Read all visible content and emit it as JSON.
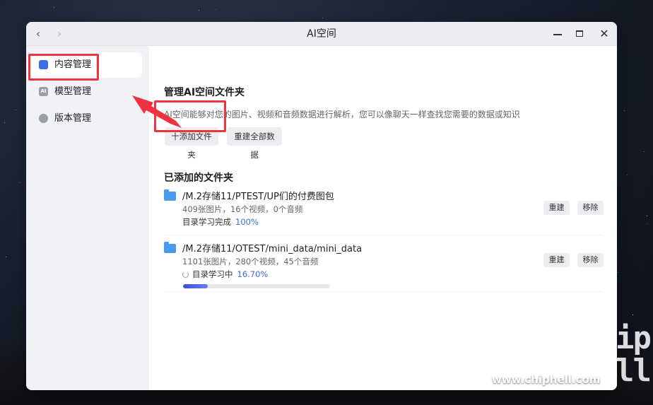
{
  "window": {
    "title": "AI空间",
    "nav_back": "‹",
    "nav_forward": "›",
    "minimize": "—",
    "maximize": "□",
    "close": "✕"
  },
  "sidebar": {
    "items": [
      {
        "label": "内容管理",
        "icon": "document-icon",
        "active": true
      },
      {
        "label": "模型管理",
        "icon": "ai-icon",
        "icon_text": "AI",
        "active": false
      },
      {
        "label": "版本管理",
        "icon": "version-icon",
        "active": false
      }
    ]
  },
  "main": {
    "manage_title": "管理AI空间文件夹",
    "manage_desc": "AI空间能够对您的图片、视频和音频数据进行解析，您可以像聊天一样查找您需要的数据或知识",
    "add_folder_label": "十添加文件夹",
    "rebuild_all_label": "重建全部数据",
    "added_title": "已添加的文件夹",
    "folders": [
      {
        "path": "/M.2存储11/PTEST/UP们的付费图包",
        "stats": "409张图片，16个视频，0个音频",
        "status": "目录学习完成",
        "percent": "100%",
        "progress": 1.0,
        "in_progress": false,
        "rebuild_label": "重建",
        "remove_label": "移除"
      },
      {
        "path": "/M.2存储11/OTEST/mini_data/mini_data",
        "stats": "1101张图片，280个视频，45个音频",
        "status": "目录学习中",
        "percent": "16.70%",
        "progress": 0.167,
        "in_progress": true,
        "rebuild_label": "重建",
        "remove_label": "移除"
      }
    ]
  },
  "colors": {
    "accent": "#3b6fe8",
    "highlight": "#ef3340",
    "folder": "#4a9af0"
  },
  "watermark": {
    "site": "www.chiphell.com",
    "logo": "chip\nhell"
  }
}
